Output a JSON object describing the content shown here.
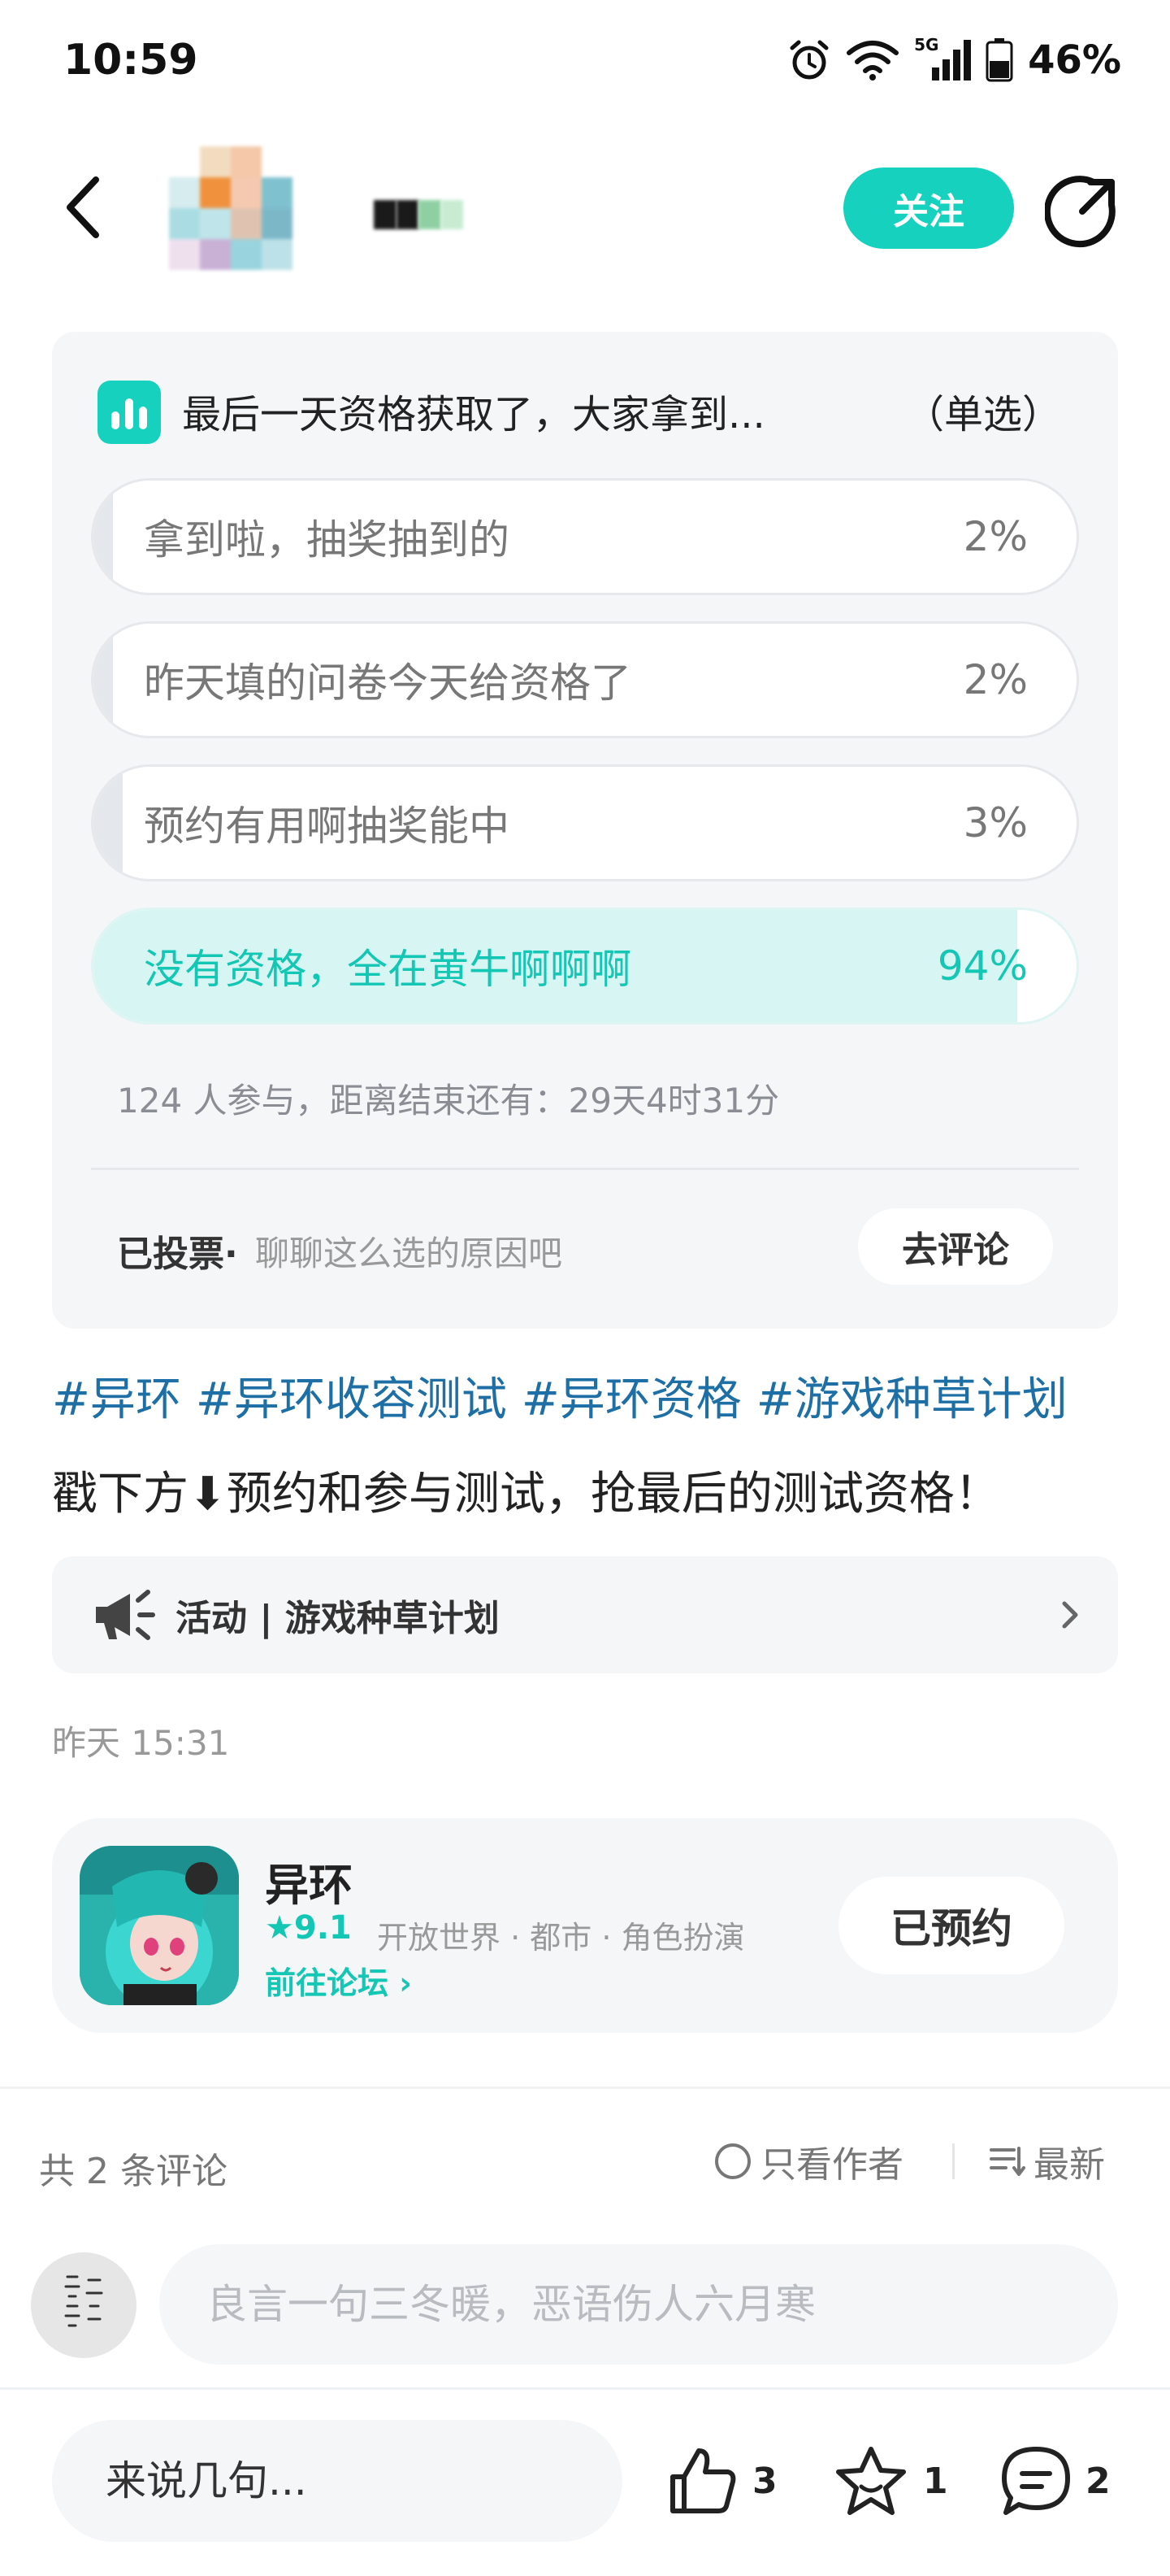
{
  "status_bar": {
    "time": "10:59",
    "signal_label": "5G",
    "battery": "46%"
  },
  "header": {
    "follow_label": "关注"
  },
  "poll": {
    "title": "最后一天资格获取了，大家拿到...",
    "type": "（单选）",
    "options": [
      {
        "label": "拿到啦，抽奖抽到的",
        "percent_text": "2%",
        "percent": 2,
        "selected": false
      },
      {
        "label": "昨天填的问卷今天给资格了",
        "percent_text": "2%",
        "percent": 2,
        "selected": false
      },
      {
        "label": "预约有用啊抽奖能中",
        "percent_text": "3%",
        "percent": 3,
        "selected": false
      },
      {
        "label": "没有资格，全在黄牛啊啊啊",
        "percent_text": "94%",
        "percent": 94,
        "selected": true
      }
    ],
    "meta": "124 人参与，距离结束还有：29天4时31分",
    "voted_label": "已投票·",
    "hint": "聊聊这么选的原因吧",
    "comment_button": "去评论"
  },
  "post": {
    "tags": [
      "#异环",
      "#异环收容测试",
      "#异环资格",
      "#游戏种草计划"
    ],
    "text": "戳下方⬇预约和参与测试，抢最后的测试资格！",
    "time": "昨天 15:31"
  },
  "activity": {
    "label": "活动 | 游戏种草计划"
  },
  "app": {
    "name": "异环",
    "rating": "9.1",
    "genres": "开放世界 · 都市 · 角色扮演",
    "forum_link": "前往论坛",
    "reserve_label": "已预约"
  },
  "comments": {
    "count_label": "共 2 条评论",
    "author_only": "只看作者",
    "sort_label": "最新",
    "input_placeholder": "良言一句三冬暖，恶语伤人六月寒"
  },
  "bottom_bar": {
    "input_placeholder": "来说几句...",
    "likes": "3",
    "favorites": "1",
    "comments": "2"
  },
  "colors": {
    "accent": "#17d1bf",
    "tag": "#1d6fa5",
    "card_bg": "#f5f6f8"
  },
  "icons": [
    "back-arrow-icon",
    "share-icon",
    "poll-chart-icon",
    "megaphone-icon",
    "chevron-right-icon",
    "star-icon",
    "sort-icon",
    "thumbs-up-icon",
    "star-outline-icon",
    "comment-bubble-icon",
    "alarm-icon",
    "wifi-icon",
    "signal-icon",
    "battery-icon"
  ]
}
